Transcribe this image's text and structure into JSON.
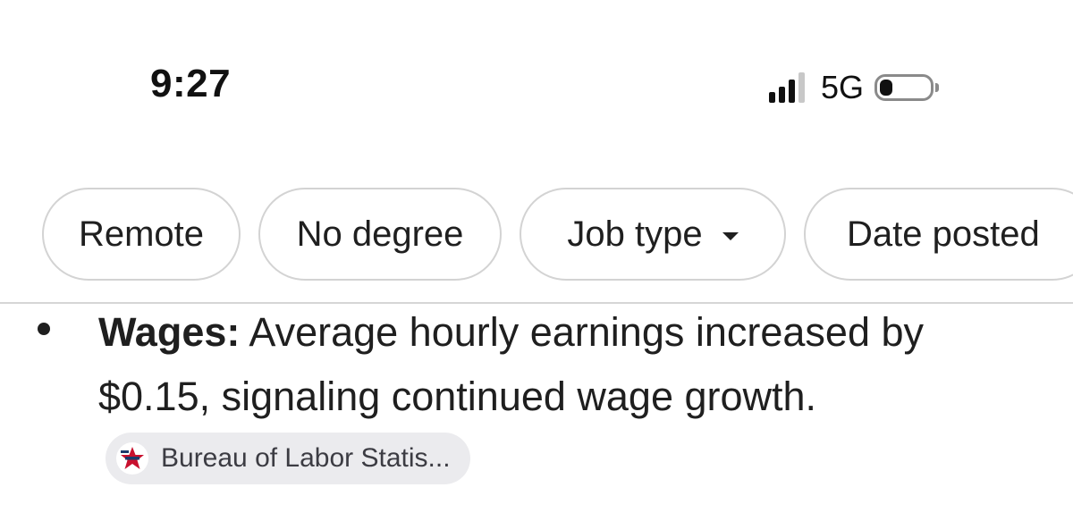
{
  "status_bar": {
    "time": "9:27",
    "network": "5G",
    "signal_bars_active": 3,
    "signal_bars_total": 4,
    "battery_level": 0.25
  },
  "filters": {
    "chips": [
      {
        "label": "Remote"
      },
      {
        "label": "No degree"
      },
      {
        "label": "Job type",
        "has_dropdown": true
      },
      {
        "label": "Date posted"
      }
    ]
  },
  "content": {
    "bullet": {
      "label": "Wages:",
      "text": " Average hourly earnings increased by $0.15, signaling continued wage growth."
    },
    "source": {
      "name": "Bureau of Labor Statis...",
      "icon": "bls-star-logo-icon"
    }
  },
  "colors": {
    "text": "#1f1f1f",
    "chip_border": "#d3d3d3",
    "source_chip_bg": "#ebebee",
    "logo_red": "#c8102e",
    "logo_blue": "#1b3a6b"
  }
}
